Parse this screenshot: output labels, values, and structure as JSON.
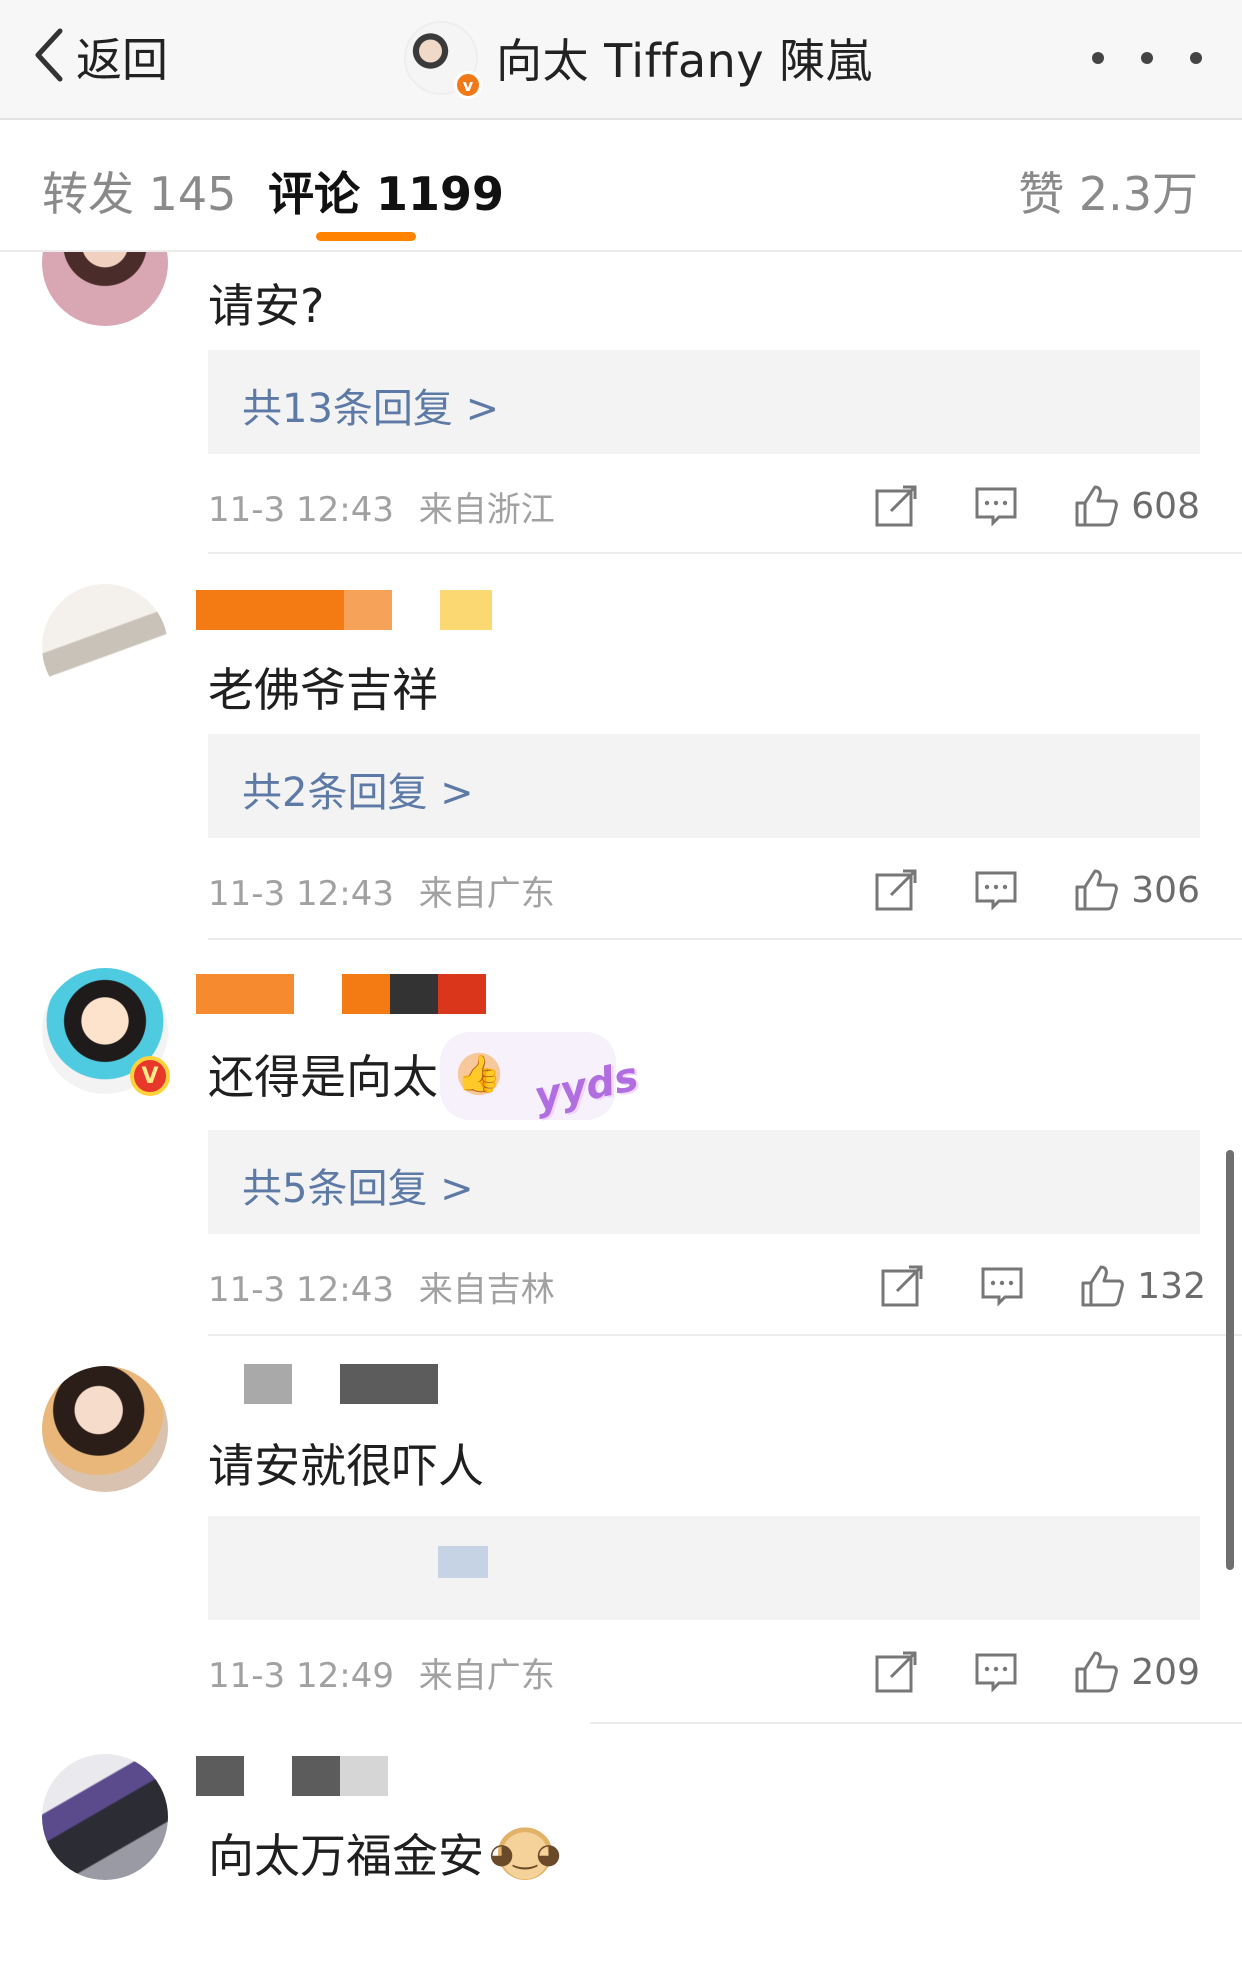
{
  "header": {
    "back_label": "返回",
    "title": "向太 Tiffany 陳嵐",
    "verified_badge": "v"
  },
  "tabs": {
    "repost": "转发 145",
    "comment": "评论 1199",
    "like": "赞 2.3万",
    "accent_color": "#ff8200"
  },
  "comments": [
    {
      "text": "请安?",
      "replies": "共13条回复 >",
      "time": "11-3 12:43",
      "location": "来自浙江",
      "likes": "608"
    },
    {
      "text": "老佛爷吉祥",
      "replies": "共2条回复 >",
      "time": "11-3 12:43",
      "location": "来自广东",
      "likes": "306"
    },
    {
      "text": "还得是向太",
      "emoji": "thumbs-up",
      "sticker": "yyds",
      "vip_badge": "V",
      "replies": "共5条回复 >",
      "time": "11-3 12:43",
      "location": "来自吉林",
      "likes": "132"
    },
    {
      "text": "请安就很吓人",
      "time": "11-3 12:49",
      "location": "来自广东",
      "likes": "209"
    },
    {
      "text": "向太万福金安",
      "emoji": "doge"
    }
  ]
}
